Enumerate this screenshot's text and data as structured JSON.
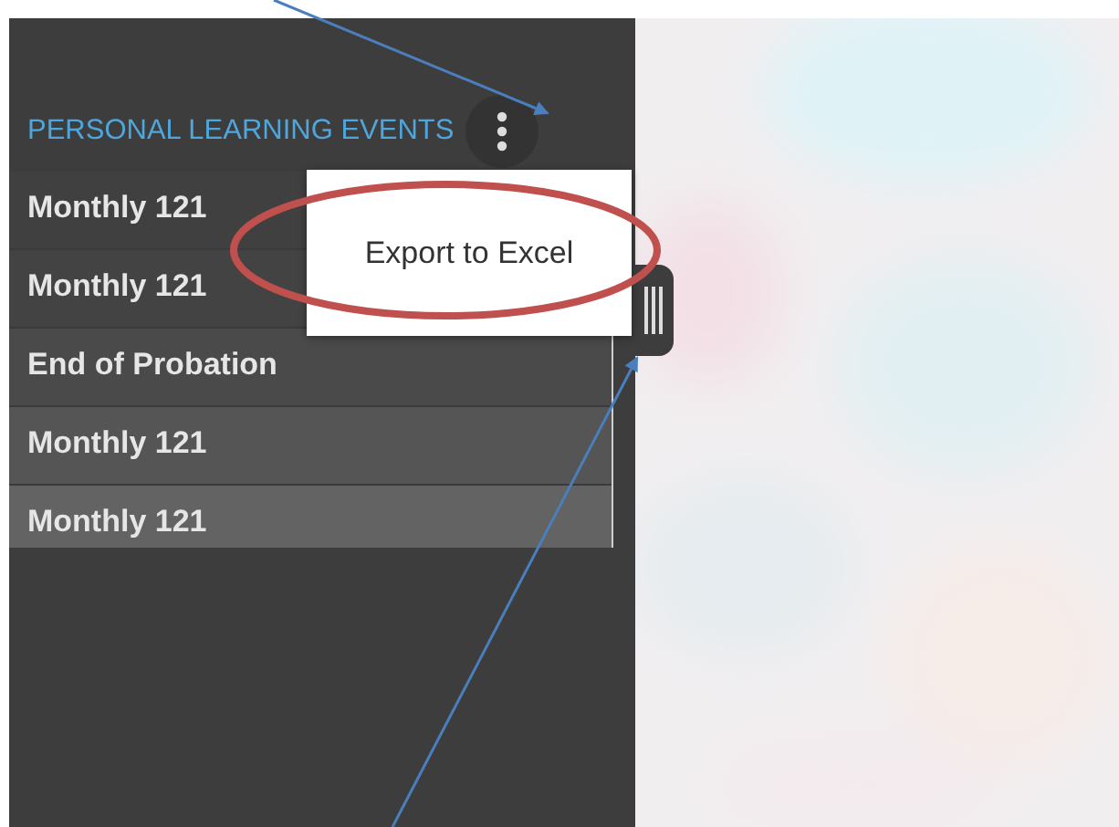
{
  "panel": {
    "title": "PERSONAL LEARNING EVENTS",
    "events": [
      {
        "name": "Monthly 121"
      },
      {
        "name": "Monthly 121"
      },
      {
        "name": "End of Probation"
      },
      {
        "name": "Monthly 121"
      },
      {
        "name": "Monthly 121"
      }
    ]
  },
  "menu": {
    "items": [
      {
        "label": "Export to Excel"
      }
    ]
  }
}
